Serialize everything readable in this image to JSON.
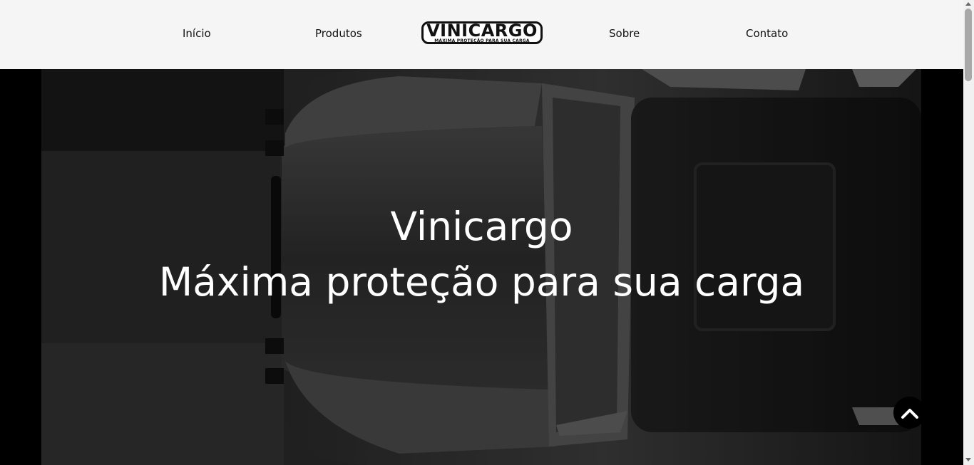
{
  "nav": {
    "inicio": "Início",
    "produtos": "Produtos",
    "sobre": "Sobre",
    "contato": "Contato"
  },
  "logo": {
    "name": "VINICARGO",
    "tagline": "MÁXIMA PROTEÇÃO PARA SUA CARGA"
  },
  "hero": {
    "title": "Vinicargo",
    "subtitle": "Máxima proteção para sua carga"
  },
  "icons": {
    "back_to_top": "chevron-up-icon"
  },
  "colors": {
    "header_bg": "#f5f5f5",
    "hero_bg": "#000000",
    "text_light": "#ffffff",
    "text_dark": "#111111"
  }
}
